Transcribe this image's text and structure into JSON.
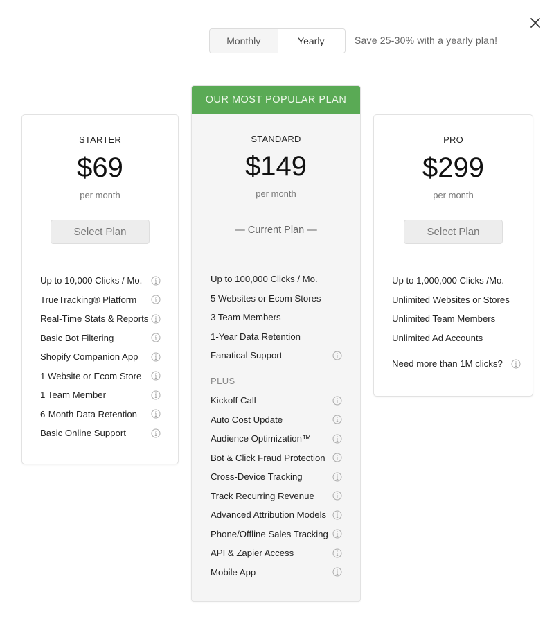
{
  "billing_toggle": {
    "options": [
      {
        "label": "Monthly",
        "selected": false
      },
      {
        "label": "Yearly",
        "selected": true
      }
    ],
    "savings_note": "Save 25-30% with a yearly plan!"
  },
  "close_icon": "close-icon",
  "plans": [
    {
      "name": "STARTER",
      "price": "$69",
      "period": "per month",
      "action_label": "Select Plan",
      "features": [
        {
          "label": "Up to 10,000 Clicks / Mo.",
          "info": true
        },
        {
          "label": "TrueTracking® Platform",
          "info": true
        },
        {
          "label": "Real-Time Stats & Reports",
          "info": true
        },
        {
          "label": "Basic Bot Filtering",
          "info": true
        },
        {
          "label": "Shopify Companion App",
          "info": true
        },
        {
          "label": "1 Website or Ecom Store",
          "info": true
        },
        {
          "label": "1 Team Member",
          "info": true
        },
        {
          "label": "6-Month Data Retention",
          "info": true
        },
        {
          "label": "Basic Online Support",
          "info": true
        }
      ]
    },
    {
      "banner": "OUR MOST POPULAR PLAN",
      "name": "STANDARD",
      "price": "$149",
      "period": "per month",
      "current_label": "— Current Plan —",
      "features": [
        {
          "label": "Up to 100,000 Clicks / Mo.",
          "info": false
        },
        {
          "label": "5 Websites or Ecom Stores",
          "info": false
        },
        {
          "label": "3 Team Members",
          "info": false
        },
        {
          "label": "1-Year Data Retention",
          "info": false
        },
        {
          "label": "Fanatical Support",
          "info": true
        }
      ],
      "plus_label": "PLUS",
      "plus_features": [
        {
          "label": "Kickoff Call",
          "info": true
        },
        {
          "label": "Auto Cost Update",
          "info": true
        },
        {
          "label": "Audience Optimization™",
          "info": true
        },
        {
          "label": "Bot & Click Fraud Protection",
          "info": true
        },
        {
          "label": "Cross-Device Tracking",
          "info": true
        },
        {
          "label": "Track Recurring Revenue",
          "info": true
        },
        {
          "label": "Advanced Attribution Models",
          "info": true
        },
        {
          "label": "Phone/Offline Sales Tracking",
          "info": true
        },
        {
          "label": "API & Zapier Access",
          "info": true
        },
        {
          "label": "Mobile App",
          "info": true
        }
      ]
    },
    {
      "name": "PRO",
      "price": "$299",
      "period": "per month",
      "action_label": "Select Plan",
      "features": [
        {
          "label": "Up to 1,000,000 Clicks /Mo.",
          "info": false
        },
        {
          "label": "Unlimited Websites or Stores",
          "info": false
        },
        {
          "label": "Unlimited Team Members",
          "info": false
        },
        {
          "label": "Unlimited Ad Accounts",
          "info": false
        }
      ],
      "extra_note": {
        "label": "Need more than 1M clicks?",
        "info": true
      }
    }
  ],
  "colors": {
    "popular_banner": "#5aaa55",
    "featured_card_bg": "#f5f5f5"
  }
}
